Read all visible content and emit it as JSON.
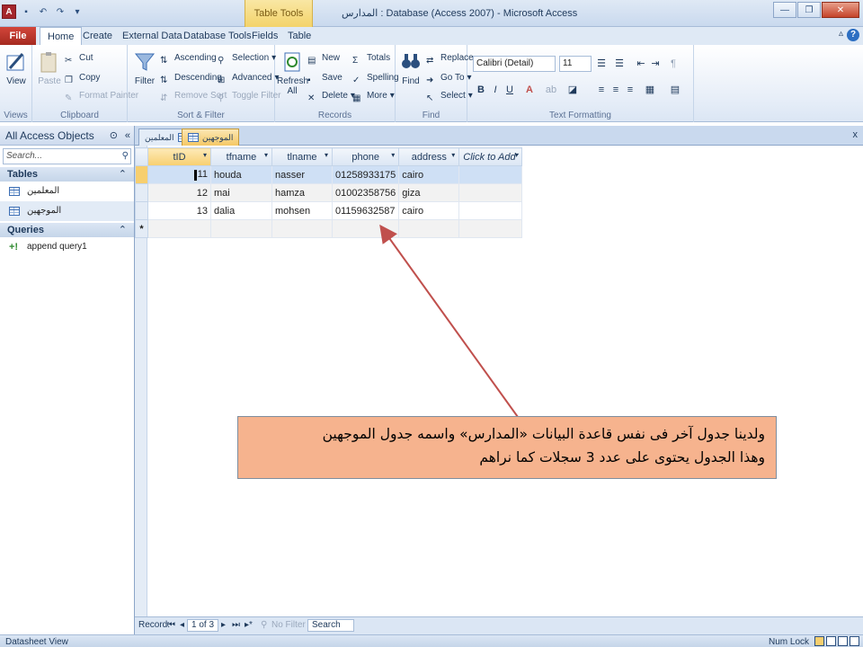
{
  "window": {
    "title": "المدارس : Database (Access 2007) - Microsoft Access",
    "context_tab": "Table Tools",
    "qat_logo": "A"
  },
  "ribbon_tabs": [
    "File",
    "Home",
    "Create",
    "External Data",
    "Database Tools",
    "Fields",
    "Table"
  ],
  "ribbon": {
    "views": {
      "view": "View",
      "group": "Views"
    },
    "clipboard": {
      "paste": "Paste",
      "cut": "Cut",
      "copy": "Copy",
      "format_painter": "Format Painter",
      "group": "Clipboard"
    },
    "sort_filter": {
      "filter": "Filter",
      "ascending": "Ascending",
      "descending": "Descending",
      "remove_sort": "Remove Sort",
      "selection": "Selection",
      "advanced": "Advanced",
      "toggle_filter": "Toggle Filter",
      "group": "Sort & Filter"
    },
    "records": {
      "refresh": "Refresh",
      "refresh_all": "All",
      "new": "New",
      "save": "Save",
      "delete": "Delete",
      "totals": "Totals",
      "spelling": "Spelling",
      "more": "More",
      "group": "Records"
    },
    "find": {
      "find": "Find",
      "replace": "Replace",
      "goto": "Go To",
      "select": "Select",
      "group": "Find"
    },
    "text_formatting": {
      "font": "Calibri (Detail)",
      "size": "11",
      "bold": "B",
      "italic": "I",
      "underline": "U",
      "group": "Text Formatting"
    }
  },
  "nav_pane": {
    "header": "All Access Objects",
    "search_placeholder": "Search...",
    "sections": [
      {
        "title": "Tables",
        "items": [
          "المعلمين",
          "الموجهين"
        ]
      },
      {
        "title": "Queries",
        "items": [
          "append query1"
        ]
      }
    ]
  },
  "doc_tabs": [
    "المعلمين",
    "الموجهين"
  ],
  "datasheet": {
    "columns": [
      "tID",
      "tfname",
      "tlname",
      "phone",
      "address",
      "Click to Add"
    ],
    "rows": [
      [
        "11",
        "houda",
        "nasser",
        "01258933175",
        "cairo"
      ],
      [
        "12",
        "mai",
        "hamza",
        "01002358756",
        "giza"
      ],
      [
        "13",
        "dalia",
        "mohsen",
        "01159632587",
        "cairo"
      ]
    ],
    "new_row_marker": "*"
  },
  "record_nav": {
    "label": "Record:",
    "position": "1 of 3",
    "filter": "No Filter",
    "search": "Search"
  },
  "status_bar": {
    "left": "Datasheet View",
    "right": "Num Lock"
  },
  "callout": {
    "line1": "ولدينا جدول آخر فى نفس قاعدة البيانات «المدارس» واسمه جدول الموجهين",
    "line2": "وهذا الجدول يحتوى على عدد 3 سجلات كما نراهم"
  },
  "colors": {
    "accent": "#a4262c",
    "callout_bg": "#f6b38e",
    "arrow": "#c0504d"
  }
}
